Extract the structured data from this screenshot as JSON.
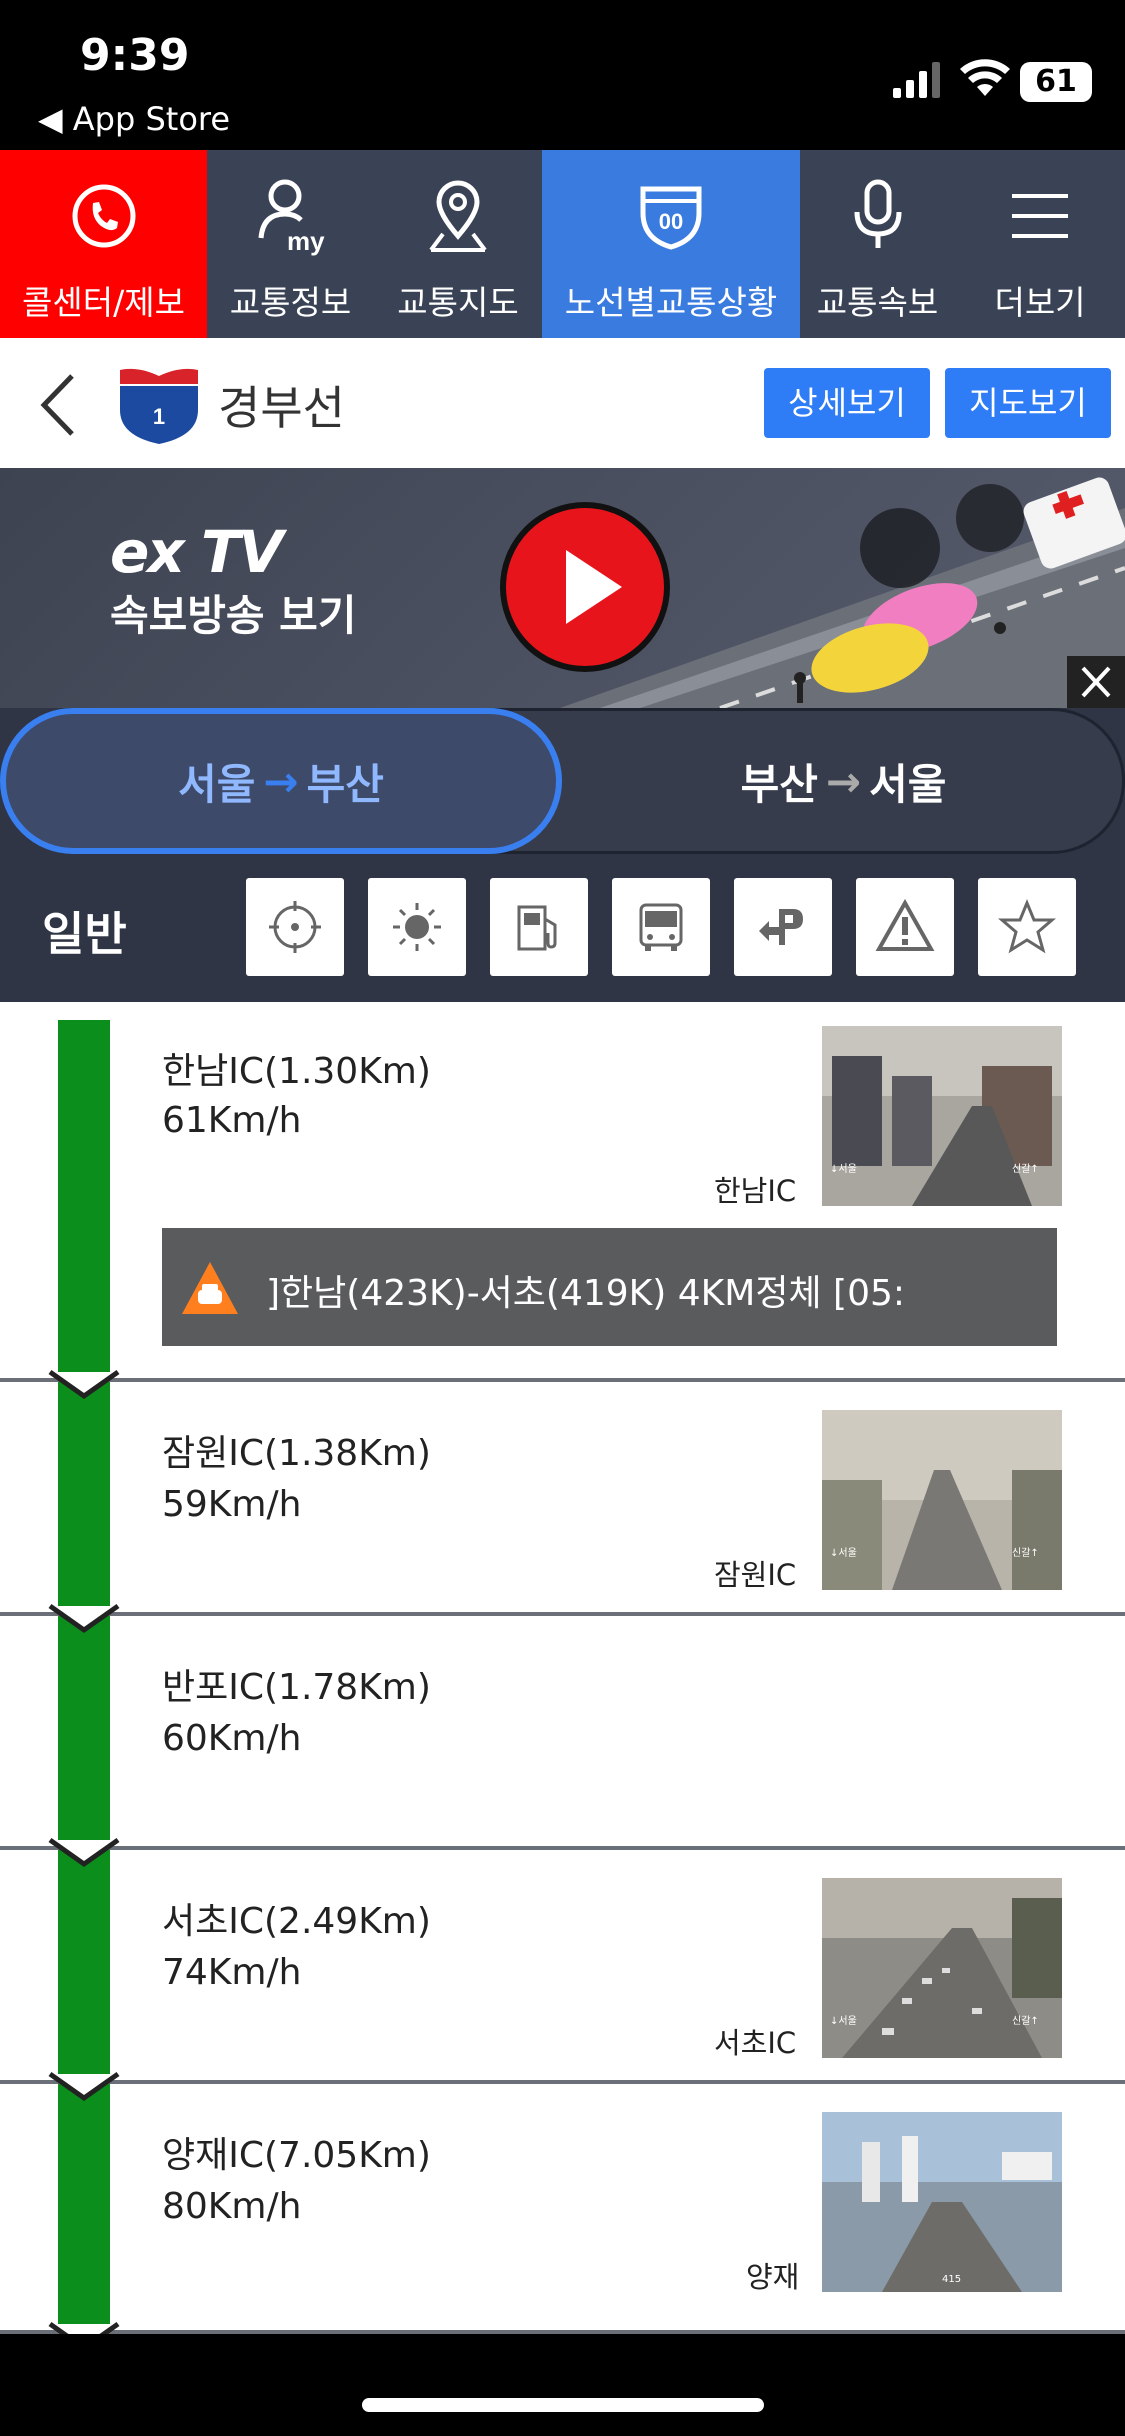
{
  "status_bar": {
    "time": "9:39",
    "back_label": "◀ App Store",
    "battery": "61"
  },
  "nav": {
    "items": [
      {
        "label": "콜센터/제보",
        "icon": "phone-icon"
      },
      {
        "label": "교통정보",
        "icon": "my-user-icon"
      },
      {
        "label": "교통지도",
        "icon": "map-pin-icon"
      },
      {
        "label": "노선별교통상황",
        "icon": "route-shield-icon"
      },
      {
        "label": "교통속보",
        "icon": "microphone-icon"
      },
      {
        "label": "더보기",
        "icon": "menu-icon"
      }
    ],
    "active_index": 3
  },
  "header": {
    "route_number": "1",
    "route_name": "경부선",
    "detail_button": "상세보기",
    "map_button": "지도보기"
  },
  "banner": {
    "logo": "ex TV",
    "text": "속보방송 보기"
  },
  "direction": {
    "active": {
      "from": "서울",
      "to": "부산"
    },
    "inactive": {
      "from": "부산",
      "to": "서울"
    }
  },
  "filter": {
    "label": "일반",
    "icons": [
      "location-target-icon",
      "weather-sun-icon",
      "gas-station-icon",
      "bus-icon",
      "parking-icon",
      "warning-icon",
      "star-icon"
    ]
  },
  "segments": [
    {
      "name": "한남IC(1.30Km)",
      "speed": "61Km/h",
      "cam_label": "한남IC",
      "has_cam": true,
      "alert": "]한남(423K)-서초(419K)  4KM정체 [05:"
    },
    {
      "name": "잠원IC(1.38Km)",
      "speed": "59Km/h",
      "cam_label": "잠원IC",
      "has_cam": true
    },
    {
      "name": "반포IC(1.78Km)",
      "speed": "60Km/h",
      "cam_label": "",
      "has_cam": false
    },
    {
      "name": "서초IC(2.49Km)",
      "speed": "74Km/h",
      "cam_label": "서초IC",
      "has_cam": true
    },
    {
      "name": "양재IC(7.05Km)",
      "speed": "80Km/h",
      "cam_label": "양재",
      "has_cam": true
    }
  ],
  "colors": {
    "nav_bg": "#3a4356",
    "call_red": "#ff0000",
    "active_blue": "#3a7be0",
    "flow_green": "#0b8e1b",
    "button_blue": "#2e7cf6"
  }
}
